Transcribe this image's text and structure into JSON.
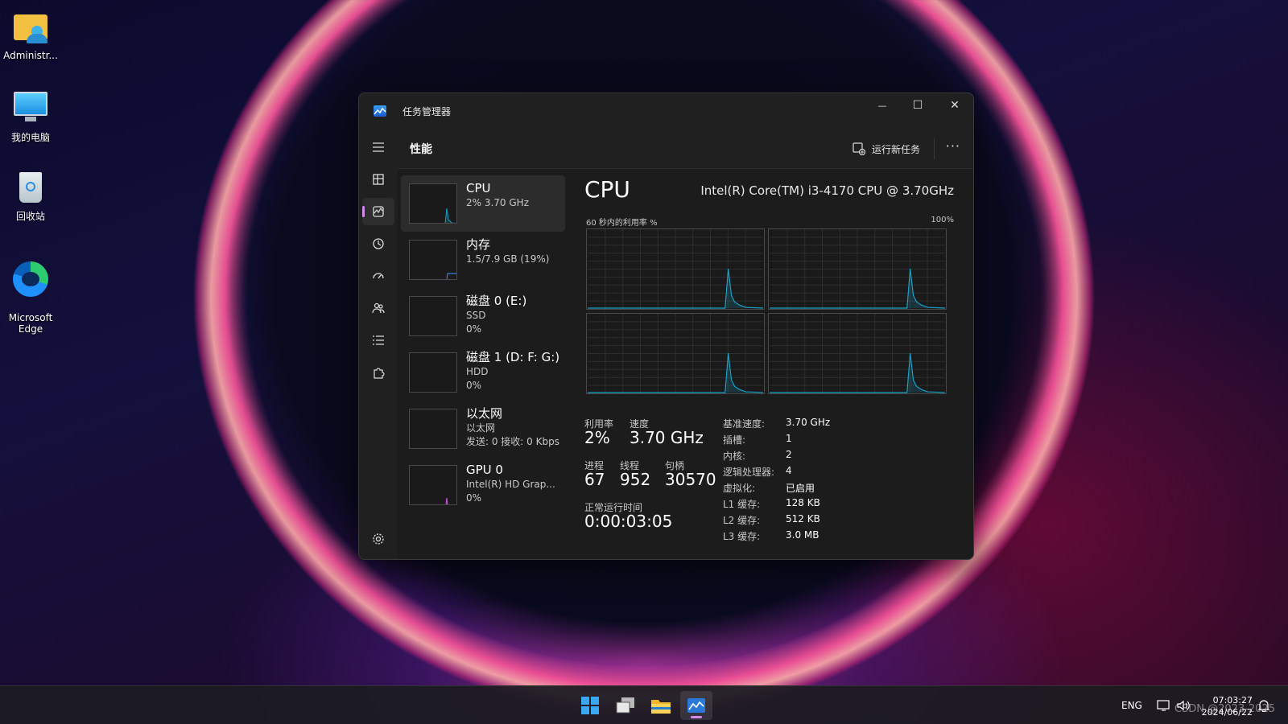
{
  "desktop": {
    "icons": [
      {
        "label": "Administr..."
      },
      {
        "label": "我的电脑"
      },
      {
        "label": "回收站"
      },
      {
        "label": "Microsoft\nEdge"
      }
    ]
  },
  "window": {
    "title": "任务管理器",
    "controls": {
      "minimize": "—",
      "maximize": "☐",
      "close": "✕"
    }
  },
  "header": {
    "title": "性能",
    "run_task": "运行新任务",
    "more": "···"
  },
  "resources": [
    {
      "name": "CPU",
      "sub1": "2% 3.70 GHz",
      "sub2": "",
      "sub3": ""
    },
    {
      "name": "内存",
      "sub1": "1.5/7.9 GB (19%)",
      "sub2": "",
      "sub3": ""
    },
    {
      "name": "磁盘 0 (E:)",
      "sub1": "SSD",
      "sub2": "0%",
      "sub3": ""
    },
    {
      "name": "磁盘 1 (D: F: G:)",
      "sub1": "HDD",
      "sub2": "0%",
      "sub3": ""
    },
    {
      "name": "以太网",
      "sub1": "以太网",
      "sub2": "发送: 0 接收: 0 Kbps",
      "sub3": ""
    },
    {
      "name": "GPU 0",
      "sub1": "Intel(R) HD Grap...",
      "sub2": "0%",
      "sub3": ""
    }
  ],
  "detail": {
    "title": "CPU",
    "model": "Intel(R) Core(TM) i3-4170 CPU @ 3.70GHz",
    "graph_label": "60 秒内的利用率 %",
    "graph_max": "100%",
    "stats": {
      "util_label": "利用率",
      "util_value": "2%",
      "speed_label": "速度",
      "speed_value": "3.70 GHz",
      "proc_label": "进程",
      "proc_value": "67",
      "thread_label": "线程",
      "thread_value": "952",
      "handle_label": "句柄",
      "handle_value": "30570",
      "uptime_label": "正常运行时间",
      "uptime_value": "0:00:03:05"
    },
    "specs": [
      {
        "k": "基准速度:",
        "v": "3.70 GHz"
      },
      {
        "k": "插槽:",
        "v": "1"
      },
      {
        "k": "内核:",
        "v": "2"
      },
      {
        "k": "逻辑处理器:",
        "v": "4"
      },
      {
        "k": "虚拟化:",
        "v": "已启用"
      },
      {
        "k": "L1 缓存:",
        "v": "128 KB"
      },
      {
        "k": "L2 缓存:",
        "v": "512 KB"
      },
      {
        "k": "L3 缓存:",
        "v": "3.0 MB"
      }
    ]
  },
  "taskbar": {
    "lang": "ENG",
    "time": "07:03:27",
    "date": "2024/06/22"
  },
  "watermark": "CSDN @2023-2025",
  "colors": {
    "accent": "#d48ae8",
    "graph_line": "#17a2c8"
  }
}
